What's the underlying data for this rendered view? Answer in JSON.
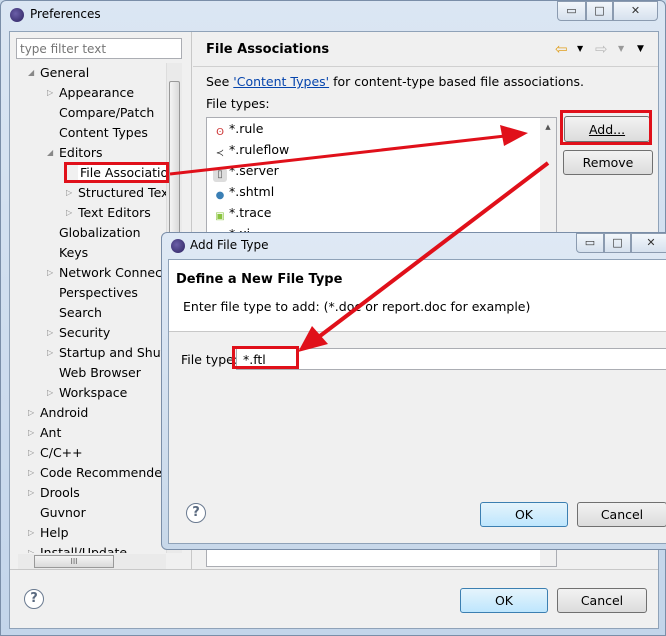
{
  "window": {
    "title": "Preferences",
    "controls": [
      "minimize",
      "maximize",
      "close"
    ]
  },
  "filter": {
    "placeholder": "type filter text"
  },
  "tree": [
    {
      "label": "General",
      "level": 0,
      "expanded": true
    },
    {
      "label": "Appearance",
      "level": 1,
      "expandable": true
    },
    {
      "label": "Compare/Patch",
      "level": 1
    },
    {
      "label": "Content Types",
      "level": 1
    },
    {
      "label": "Editors",
      "level": 1,
      "expanded": true
    },
    {
      "label": "File Associations",
      "level": 2,
      "selected": true
    },
    {
      "label": "Structured Text",
      "level": 2,
      "expandable": true
    },
    {
      "label": "Text Editors",
      "level": 2,
      "expandable": true
    },
    {
      "label": "Globalization",
      "level": 1
    },
    {
      "label": "Keys",
      "level": 1
    },
    {
      "label": "Network Connections",
      "level": 1,
      "expandable": true
    },
    {
      "label": "Perspectives",
      "level": 1
    },
    {
      "label": "Search",
      "level": 1
    },
    {
      "label": "Security",
      "level": 1,
      "expandable": true
    },
    {
      "label": "Startup and Shutdown",
      "level": 1,
      "expandable": true
    },
    {
      "label": "Web Browser",
      "level": 1
    },
    {
      "label": "Workspace",
      "level": 1,
      "expandable": true
    },
    {
      "label": "Android",
      "level": 0,
      "expandable": true
    },
    {
      "label": "Ant",
      "level": 0,
      "expandable": true
    },
    {
      "label": "C/C++",
      "level": 0,
      "expandable": true
    },
    {
      "label": "Code Recommenders",
      "level": 0,
      "expandable": true
    },
    {
      "label": "Drools",
      "level": 0,
      "expandable": true
    },
    {
      "label": "Guvnor",
      "level": 0
    },
    {
      "label": "Help",
      "level": 0,
      "expandable": true
    },
    {
      "label": "Install/Update",
      "level": 0,
      "expandable": true
    }
  ],
  "page": {
    "title": "File Associations",
    "desc_prefix": "See ",
    "desc_link": "'Content Types'",
    "desc_suffix": " for content-type based file associations.",
    "file_types_label": "File types:",
    "file_types": [
      {
        "name": "*.rule",
        "icon": "drools-rule-icon"
      },
      {
        "name": "*.ruleflow",
        "icon": "ruleflow-icon"
      },
      {
        "name": "*.server",
        "icon": "server-icon"
      },
      {
        "name": "*.shtml",
        "icon": "globe-icon"
      },
      {
        "name": "*.trace",
        "icon": "android-icon"
      },
      {
        "name": "*.xi",
        "icon": "file-icon"
      }
    ],
    "add_label": "Add...",
    "remove_label": "Remove"
  },
  "footer": {
    "ok": "OK",
    "cancel": "Cancel"
  },
  "dialog": {
    "title": "Add File Type",
    "heading": "Define a New File Type",
    "message": "Enter file type to add: (*.doc or report.doc for example)",
    "field_label": "File type:",
    "field_value": "*.ftl",
    "ok": "OK",
    "cancel": "Cancel"
  },
  "annotation_color": "#e0101a"
}
